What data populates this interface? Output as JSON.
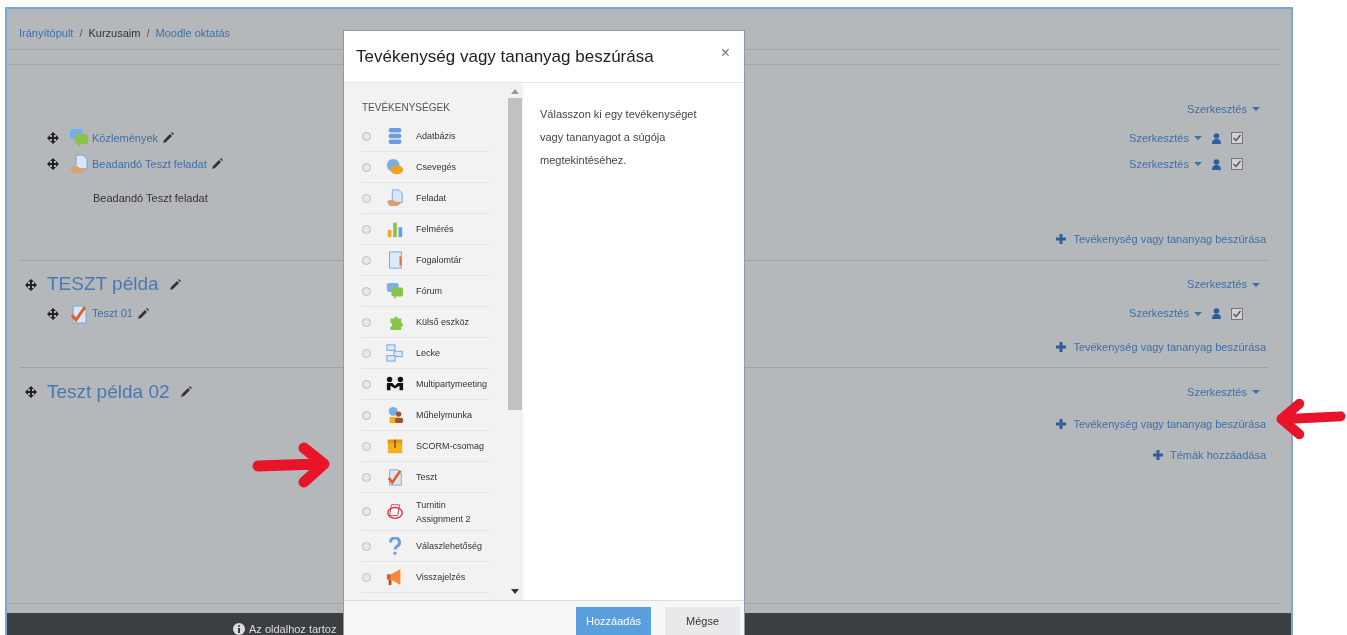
{
  "breadcrumb": [
    {
      "label": "Irányítópult",
      "kind": "link"
    },
    {
      "label": "/",
      "kind": "separator"
    },
    {
      "label": "Kurzusaim",
      "kind": "text"
    },
    {
      "label": "/",
      "kind": "separator"
    },
    {
      "label": "Moodle oktatás",
      "kind": "link"
    }
  ],
  "sections": [
    {
      "edit_menu": "Szerkesztés",
      "activities": [
        {
          "kind": "forum",
          "name": "Közlemények",
          "edit": "Szerkesztés"
        },
        {
          "kind": "assign",
          "name": "Beadandó Teszt feladat",
          "edit": "Szerkesztés",
          "description": "Beadandó Teszt feladat"
        }
      ],
      "add_activity": "Tevékenység vagy tananyag beszúrása"
    },
    {
      "title": "TESZT példa",
      "edit_menu": "Szerkesztés",
      "activities": [
        {
          "kind": "quiz",
          "name": "Teszt 01",
          "edit": "Szerkesztés"
        }
      ],
      "add_activity": "Tevékenység vagy tananyag beszúrása"
    },
    {
      "title": "Teszt példa 02",
      "edit_menu": "Szerkesztés",
      "add_activity": "Tevékenység vagy tananyag beszúrása",
      "add_topics": "Témák hozzáadása"
    }
  ],
  "footer": {
    "text": "Az oldalhoz tartoz"
  },
  "modal": {
    "title": "Tevékenység vagy tananyag beszúrása",
    "close": "×",
    "category": "TEVÉKENYSÉGEK",
    "help": "Válasszon ki egy tevékenységet vagy tananyagot a súgója megtekintéséhez.",
    "items": [
      {
        "kind": "database",
        "label": "Adatbázis",
        "selected": false
      },
      {
        "kind": "chat",
        "label": "Csevegés",
        "selected": false
      },
      {
        "kind": "assign",
        "label": "Feladat",
        "selected": false
      },
      {
        "kind": "survey",
        "label": "Felmérés",
        "selected": false
      },
      {
        "kind": "glossary",
        "label": "Fogalomtár",
        "selected": false
      },
      {
        "kind": "forum",
        "label": "Fórum",
        "selected": false
      },
      {
        "kind": "lti",
        "label": "Külső eszköz",
        "selected": false
      },
      {
        "kind": "lesson",
        "label": "Lecke",
        "selected": false
      },
      {
        "kind": "meeting",
        "label": "Multipartymeeting",
        "selected": false
      },
      {
        "kind": "workshop",
        "label": "Műhelymunka",
        "selected": false
      },
      {
        "kind": "scorm",
        "label": "SCORM-csomag",
        "selected": false
      },
      {
        "kind": "quiz",
        "label": "Teszt",
        "selected": false
      },
      {
        "kind": "turnitin",
        "label": "Turnitin Assignment 2",
        "selected": false
      },
      {
        "kind": "choice",
        "label": "Válaszlehetőség",
        "selected": false
      },
      {
        "kind": "feedback",
        "label": "Visszajelzés",
        "selected": false
      }
    ],
    "buttons": [
      {
        "label": "Hozzáadás",
        "kind": "primary"
      },
      {
        "label": "Mégse",
        "kind": "secondary"
      }
    ]
  },
  "annotations": [
    {
      "kind": "arrow_right"
    },
    {
      "kind": "arrow_left"
    }
  ]
}
